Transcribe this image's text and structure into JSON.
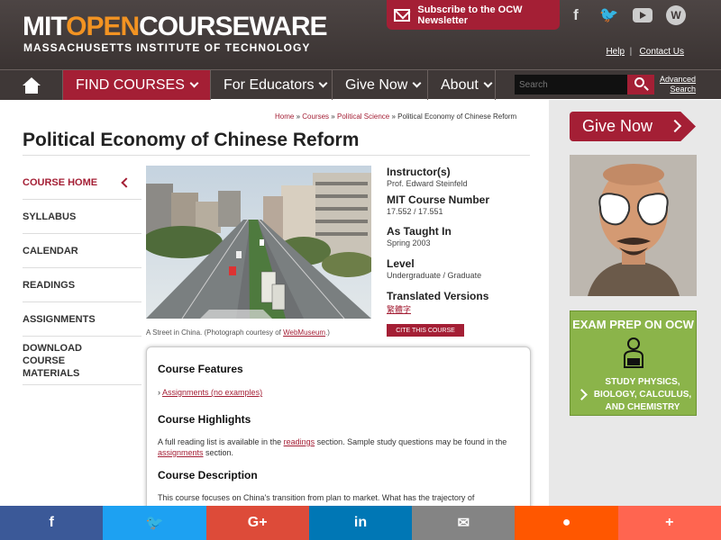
{
  "header": {
    "logo_part1": "MIT",
    "logo_part2": "OPEN",
    "logo_part3": "COURSEWARE",
    "logo_sub": "MASSACHUSETTS INSTITUTE OF TECHNOLOGY",
    "newsletter_label": "Subscribe to the OCW Newsletter",
    "social": [
      "facebook-icon",
      "twitter-icon",
      "youtube-icon",
      "wordpress-icon"
    ],
    "help_label": "Help",
    "contact_label": "Contact Us"
  },
  "nav": {
    "find_courses": "FIND COURSES",
    "for_educators": "For Educators",
    "give_now": "Give Now",
    "about": "About",
    "search_placeholder": "Search",
    "advanced_search_line1": "Advanced",
    "advanced_search_line2": "Search"
  },
  "breadcrumb": {
    "home": "Home",
    "courses": "Courses",
    "department": "Political Science",
    "current": "Political Economy of Chinese Reform",
    "sep": "»"
  },
  "page_title": "Political Economy of Chinese Reform",
  "sidebar": {
    "items": [
      {
        "label": "COURSE HOME",
        "active": true
      },
      {
        "label": "SYLLABUS"
      },
      {
        "label": "CALENDAR"
      },
      {
        "label": "READINGS"
      },
      {
        "label": "ASSIGNMENTS"
      },
      {
        "label": "DOWNLOAD COURSE MATERIALS"
      }
    ]
  },
  "photo": {
    "caption_prefix": "A Street in China. (Photograph courtesy of ",
    "caption_link": "WebMuseum",
    "caption_suffix": ".)"
  },
  "course_info": {
    "instructor_label": "Instructor(s)",
    "instructor": "Prof. Edward Steinfeld",
    "number_label": "MIT Course Number",
    "number": "17.552 / 17.551",
    "taught_label": "As Taught In",
    "taught": "Spring 2003",
    "level_label": "Level",
    "level": "Undergraduate / Graduate",
    "translated_label": "Translated Versions",
    "translated": "繁體字",
    "cite_label": "CITE THIS COURSE"
  },
  "features": {
    "features_heading": "Course Features",
    "feature_link": "Assignments (no examples)",
    "highlights_heading": "Course Highlights",
    "highlights_text_1": "A full reading list is available in the ",
    "highlights_link_1": "readings",
    "highlights_text_2": " section. Sample study questions may be found in the ",
    "highlights_link_2": "assignments",
    "highlights_text_3": " section.",
    "description_heading": "Course Description",
    "description_text": "This course focuses on China's transition from plan to market. What has the trajectory of"
  },
  "right_column": {
    "give_now": "Give Now",
    "exam_title": "EXAM PREP ON OCW",
    "exam_body": "STUDY PHYSICS, BIOLOGY, CALCULUS, AND CHEMISTRY"
  },
  "sharebar": {
    "items": [
      {
        "icon": "facebook-icon",
        "glyph": "f",
        "color": "#3b5998"
      },
      {
        "icon": "twitter-icon",
        "glyph": "🐦",
        "color": "#1da1f2"
      },
      {
        "icon": "google-plus-icon",
        "glyph": "G+",
        "color": "#dd4b39"
      },
      {
        "icon": "linkedin-icon",
        "glyph": "in",
        "color": "#0077b5"
      },
      {
        "icon": "email-icon",
        "glyph": "✉",
        "color": "#848484"
      },
      {
        "icon": "reddit-icon",
        "glyph": "●",
        "color": "#ff5700"
      },
      {
        "icon": "more-icon",
        "glyph": "+",
        "color": "#ff6550"
      }
    ]
  }
}
